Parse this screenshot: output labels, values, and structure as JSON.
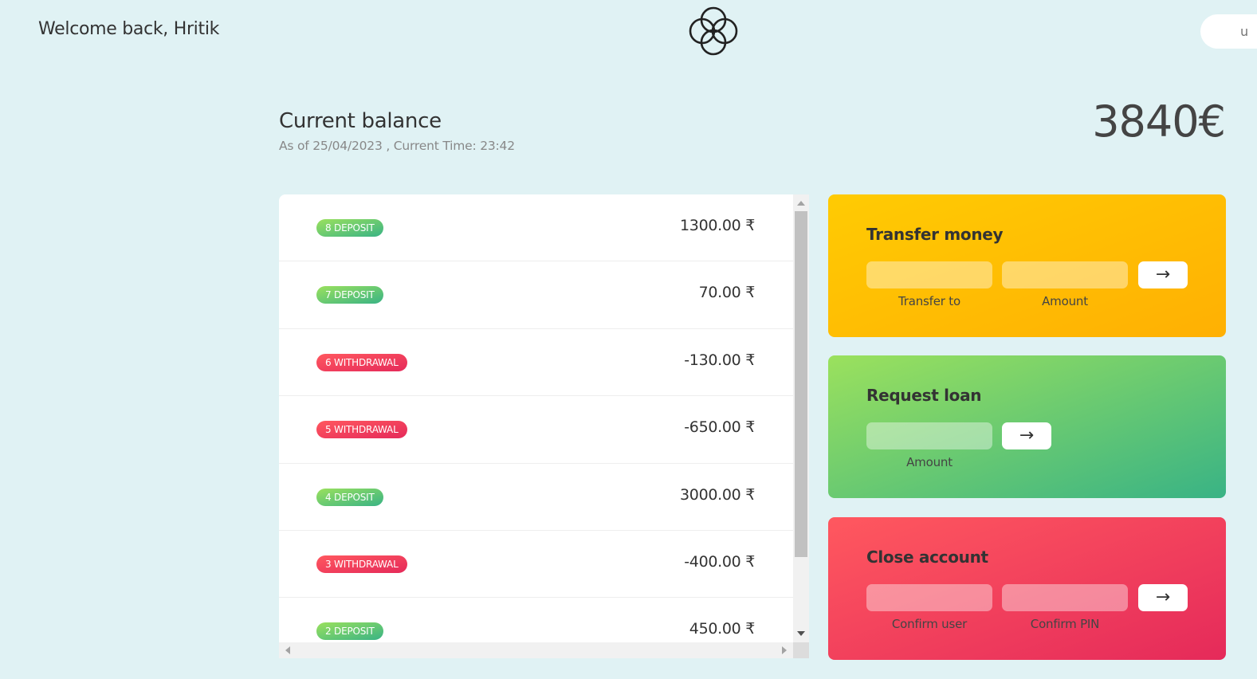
{
  "header": {
    "welcome": "Welcome back, Hritik",
    "login_partial": "u"
  },
  "balance": {
    "title": "Current balance",
    "date_line": "As of 25/04/2023 , Current Time: 23:42",
    "value": "3840€"
  },
  "movements": [
    {
      "label": "8 DEPOSIT",
      "type": "deposit",
      "amount": "1300.00 ₹"
    },
    {
      "label": "7 DEPOSIT",
      "type": "deposit",
      "amount": "70.00 ₹"
    },
    {
      "label": "6 WITHDRAWAL",
      "type": "withdrawal",
      "amount": "-130.00 ₹"
    },
    {
      "label": "5 WITHDRAWAL",
      "type": "withdrawal",
      "amount": "-650.00 ₹"
    },
    {
      "label": "4 DEPOSIT",
      "type": "deposit",
      "amount": "3000.00 ₹"
    },
    {
      "label": "3 WITHDRAWAL",
      "type": "withdrawal",
      "amount": "-400.00 ₹"
    },
    {
      "label": "2 DEPOSIT",
      "type": "deposit",
      "amount": "450.00 ₹"
    }
  ],
  "operations": {
    "transfer": {
      "title": "Transfer money",
      "label_to": "Transfer to",
      "label_amount": "Amount",
      "button": "→"
    },
    "loan": {
      "title": "Request loan",
      "label_amount": "Amount",
      "button": "→"
    },
    "close": {
      "title": "Close account",
      "label_user": "Confirm user",
      "label_pin": "Confirm PIN",
      "button": "→"
    }
  },
  "colors": {
    "background": "#e0f2f4",
    "deposit_gradient": [
      "#39b385",
      "#9be15d"
    ],
    "withdrawal_gradient": [
      "#e52a5a",
      "#ff585f"
    ],
    "transfer_gradient": [
      "#ffb003",
      "#ffcb03"
    ]
  },
  "icons": {
    "logo": "four-circle-logo-icon"
  }
}
